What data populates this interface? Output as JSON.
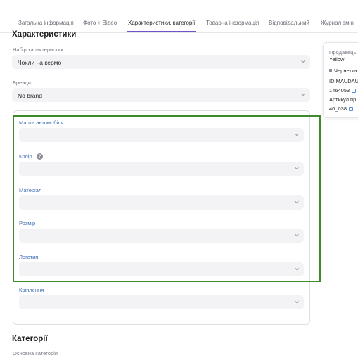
{
  "tabs": [
    {
      "label": "Загальна інформація"
    },
    {
      "label": "Фото + Відео"
    },
    {
      "label": "Характеристики, категорії"
    },
    {
      "label": "Товарна інформація"
    },
    {
      "label": "Відповідальний"
    },
    {
      "label": "Журнал змін"
    }
  ],
  "active_tab": "Характеристики, категорії",
  "characteristics": {
    "title": "Характеристики",
    "set_label": "Набір характеристик",
    "set_value": "Чохли на кермо",
    "brands_label": "Бренди",
    "brands_value": "No brand",
    "fields": [
      {
        "label": "Марка автомобіля",
        "value": ""
      },
      {
        "label": "Колір",
        "value": "",
        "help": "?"
      },
      {
        "label": "Матеріал",
        "value": ""
      },
      {
        "label": "Розмір",
        "value": ""
      },
      {
        "label": "Логотип",
        "value": ""
      },
      {
        "label": "Кріплення",
        "value": ""
      }
    ]
  },
  "categories": {
    "title": "Категорії",
    "main_label": "Основна категорія"
  },
  "side_panel": {
    "seller_label": "Продавець",
    "seller_value": "Yellow",
    "status": "Чернетка",
    "id_label": "ID MAUDAU",
    "id_value": "1464053",
    "article_label": "Артикул пр",
    "article_value": "40_038"
  },
  "colors": {
    "accent": "#6f54c8",
    "highlight_border": "#3e8a2a",
    "field_label": "#3f6fb5",
    "input_bg": "#f3f3f6"
  }
}
